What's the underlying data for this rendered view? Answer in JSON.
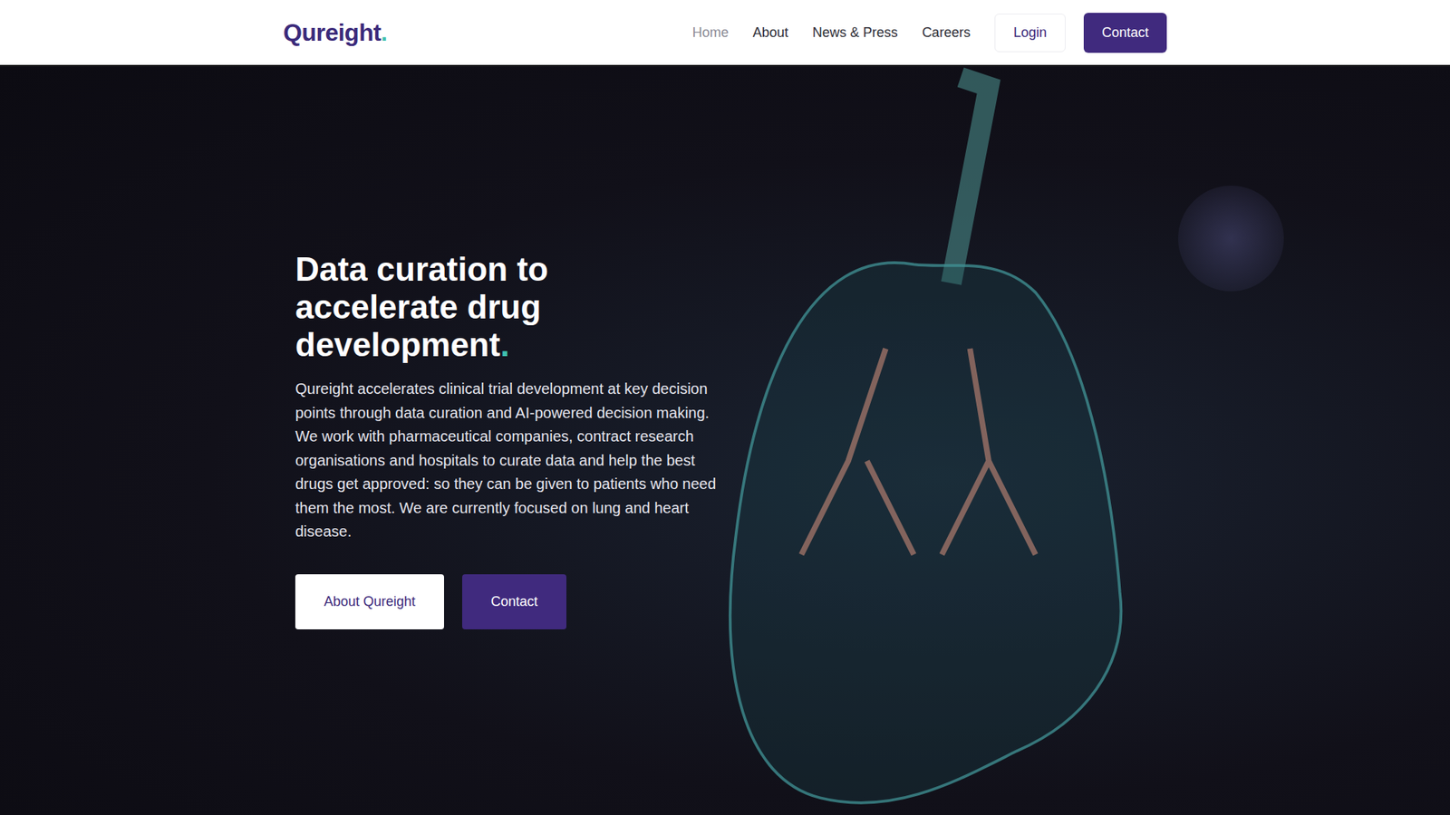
{
  "logo": {
    "text": "Qureight",
    "dot": "."
  },
  "nav": {
    "links": [
      {
        "label": "Home",
        "selected": true
      },
      {
        "label": "About",
        "selected": false
      },
      {
        "label": "News & Press",
        "selected": false
      },
      {
        "label": "Careers",
        "selected": false
      }
    ],
    "login": "Login",
    "contact": "Contact"
  },
  "hero": {
    "title": "Data curation to accelerate drug development",
    "title_accent": ".",
    "body": "Qureight accelerates clinical trial development at key decision points through data curation and AI-powered decision making. We work with pharmaceutical companies, contract research organisations and hospitals to curate data and help the best drugs get approved: so they can be given to patients who need them the most. We are currently focused on lung and heart disease.",
    "buttons": [
      {
        "label": "About Qureight",
        "kind": "secondary"
      },
      {
        "label": "Contact",
        "kind": "primary"
      }
    ]
  }
}
